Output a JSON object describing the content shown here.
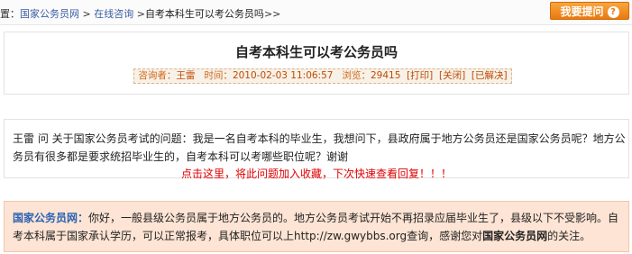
{
  "breadcrumb": {
    "lead": "置",
    "home": "国家公务员网",
    "sep1": " > ",
    "section": "在线咨询",
    "sep2": " >",
    "current": "自考本科生可以考公务员吗",
    "tail": ">>"
  },
  "ask_button": {
    "label": "我要提问",
    "icon": "?"
  },
  "question": {
    "title": "自考本科生可以考公务员吗",
    "meta": {
      "asker_label": "咨询者：",
      "asker": "王雷",
      "time_label": "时间：",
      "time": "2010-02-03 11:06:57",
      "views_label": "浏览：",
      "views": "29415",
      "print": "[打印]",
      "close": "[关闭]",
      "status": "[已解决]"
    },
    "body": "王雷 问 关于国家公务员考试的问题：我是一名自考本科的毕业生，我想问下，县政府属于地方公务员还是国家公务员呢？地方公务员有很多都是要求统招毕业生的，自考本科可以考哪些职位呢？谢谢",
    "favorite_link": "点击这里，将此问题加入收藏，下次快速查看回复！！！"
  },
  "answer": {
    "source": "国家公务员网：",
    "text": "你好，一般县级公务员属于地方公务员的。地方公务员考试开始不再招录应届毕业生了，县级以下不受影响。自考本科属于国家承认学历，可以正常报考，具体职位可以上http://zw.gwybbs.org查询，感谢您对",
    "site": "国家公务员网",
    "end": "的关注。"
  },
  "colors": {
    "accent_orange": "#e9790f",
    "meta_text": "#d06616",
    "link_blue": "#2b62b3",
    "alert_red": "#e00000",
    "answer_bg": "#fde4d4"
  }
}
